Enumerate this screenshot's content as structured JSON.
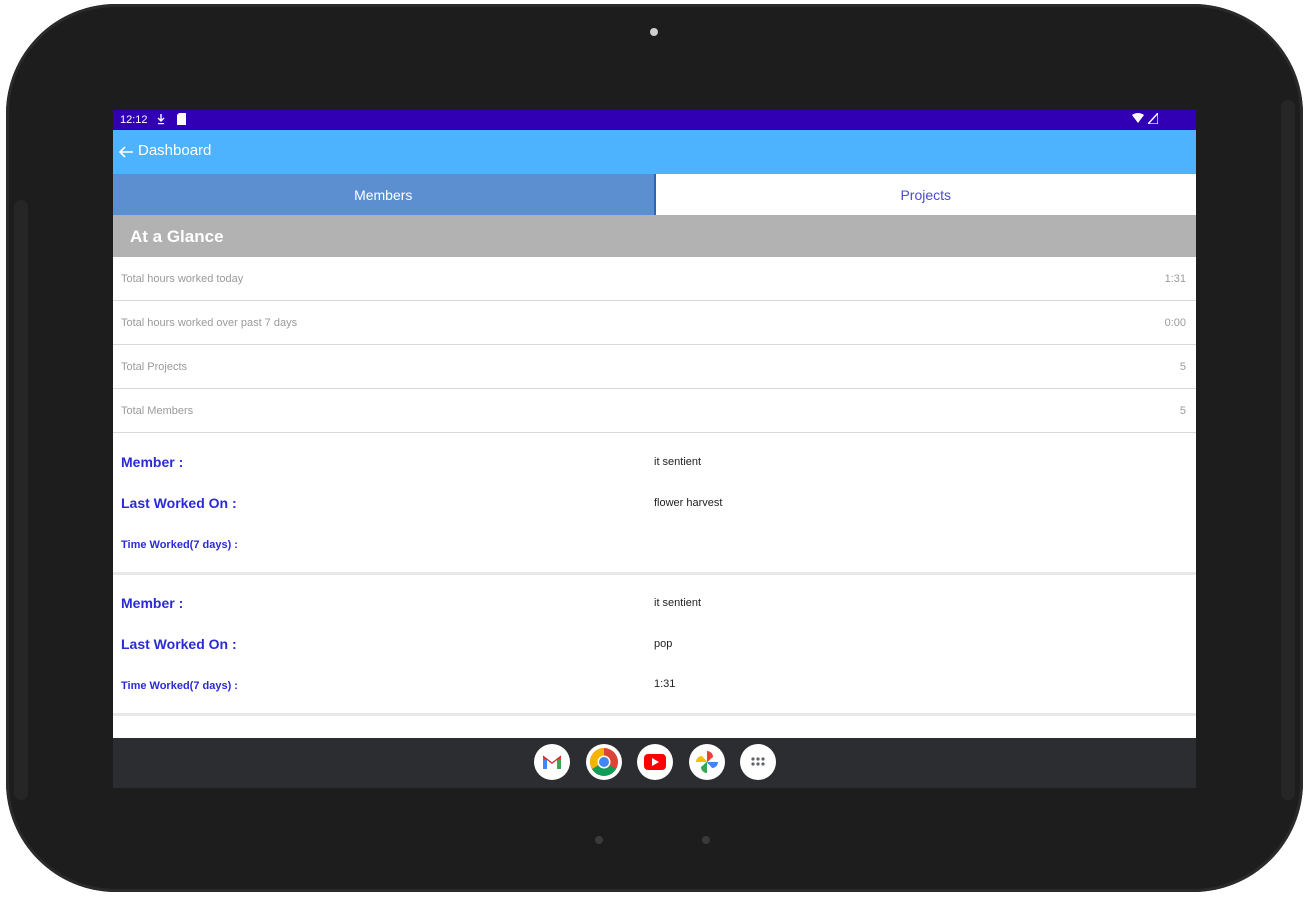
{
  "status_bar": {
    "time": "12:12"
  },
  "app_bar": {
    "title": "Dashboard"
  },
  "tabs": [
    {
      "label": "Members",
      "active": true
    },
    {
      "label": "Projects",
      "active": false
    }
  ],
  "section": {
    "title": "At a Glance"
  },
  "stats": [
    {
      "label": "Total hours worked today",
      "value": "1:31"
    },
    {
      "label": "Total hours worked over past 7 days",
      "value": "0:00"
    },
    {
      "label": "Total Projects",
      "value": "5"
    },
    {
      "label": "Total Members",
      "value": "5"
    }
  ],
  "members": [
    {
      "member_label": "Member :",
      "member_value": "it sentient",
      "last_worked_label": "Last Worked On :",
      "last_worked_value": "flower harvest",
      "time_worked_label": "Time Worked(7 days) :",
      "time_worked_value": ""
    },
    {
      "member_label": "Member :",
      "member_value": "it sentient",
      "last_worked_label": "Last Worked On :",
      "last_worked_value": "pop",
      "time_worked_label": "Time Worked(7 days) :",
      "time_worked_value": "1:31"
    }
  ],
  "dock": [
    "gmail-icon",
    "chrome-icon",
    "youtube-icon",
    "photos-icon",
    "app-drawer-icon"
  ],
  "colors": {
    "status_bar": "#3200b4",
    "app_bar": "#4db3ff",
    "tab_active": "#5b8fd0",
    "section_header": "#b2b2b2",
    "label_blue": "#2a2ad8"
  }
}
